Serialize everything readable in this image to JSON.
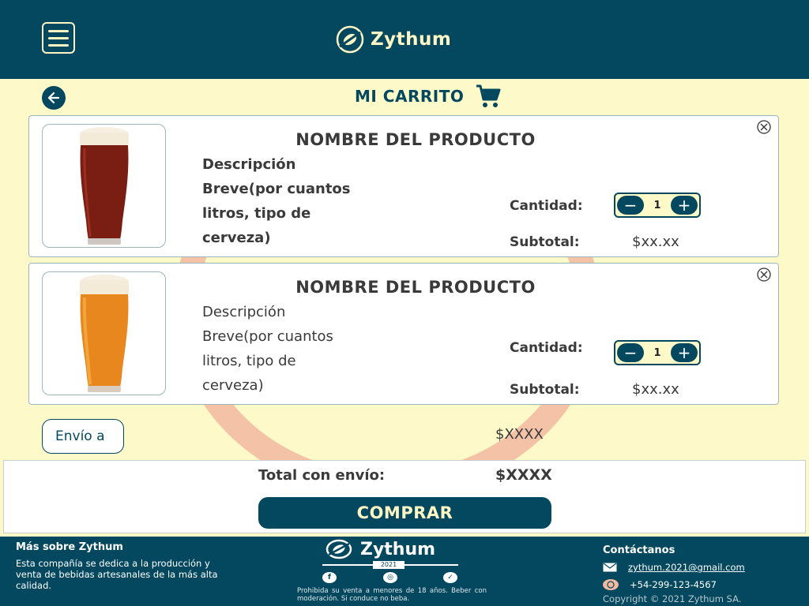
{
  "header": {
    "brand": "Zythum"
  },
  "cart": {
    "title": "MI CARRITO"
  },
  "items": [
    {
      "name": "NOMBRE DEL PRODUCTO",
      "description": "Descripción Breve(por cuantos litros, tipo de cerveza)",
      "quantity_label": "Cantidad:",
      "quantity": "1",
      "subtotal_label": "Subtotal:",
      "subtotal": "$xx.xx",
      "image": "dark-beer-glass"
    },
    {
      "name": "NOMBRE DEL PRODUCTO",
      "description": "Descripción Breve(por cuantos litros, tipo de cerveza)",
      "quantity_label": "Cantidad:",
      "quantity": "1",
      "subtotal_label": "Subtotal:",
      "subtotal": "$xx.xx",
      "image": "amber-beer-glass"
    }
  ],
  "shipping": {
    "button_label": "Envío a",
    "value": "$XXXX"
  },
  "total": {
    "label": "Total con envío:",
    "value": "$XXXX",
    "buy_label": "COMPRAR"
  },
  "footer": {
    "about_title": "Más sobre Zythum",
    "about_text": "Esta compañía se dedica a la producción y venta de bebidas artesanales de la más alta calidad.",
    "brand": "Zythum",
    "year": "2021",
    "legal": "Prohibida su venta a menores de 18 años. Beber con moderación. Si conduce no beba.",
    "contact_title": "Contáctanos",
    "email": "zythum.2021@gmail.com",
    "phone": "+54-299-123-4567",
    "copyright": "Copyright © 2021 Zythum SA."
  },
  "colors": {
    "primary": "#04485f",
    "cream": "#fdf9c8",
    "accent_ring": "#f2b8a0"
  }
}
